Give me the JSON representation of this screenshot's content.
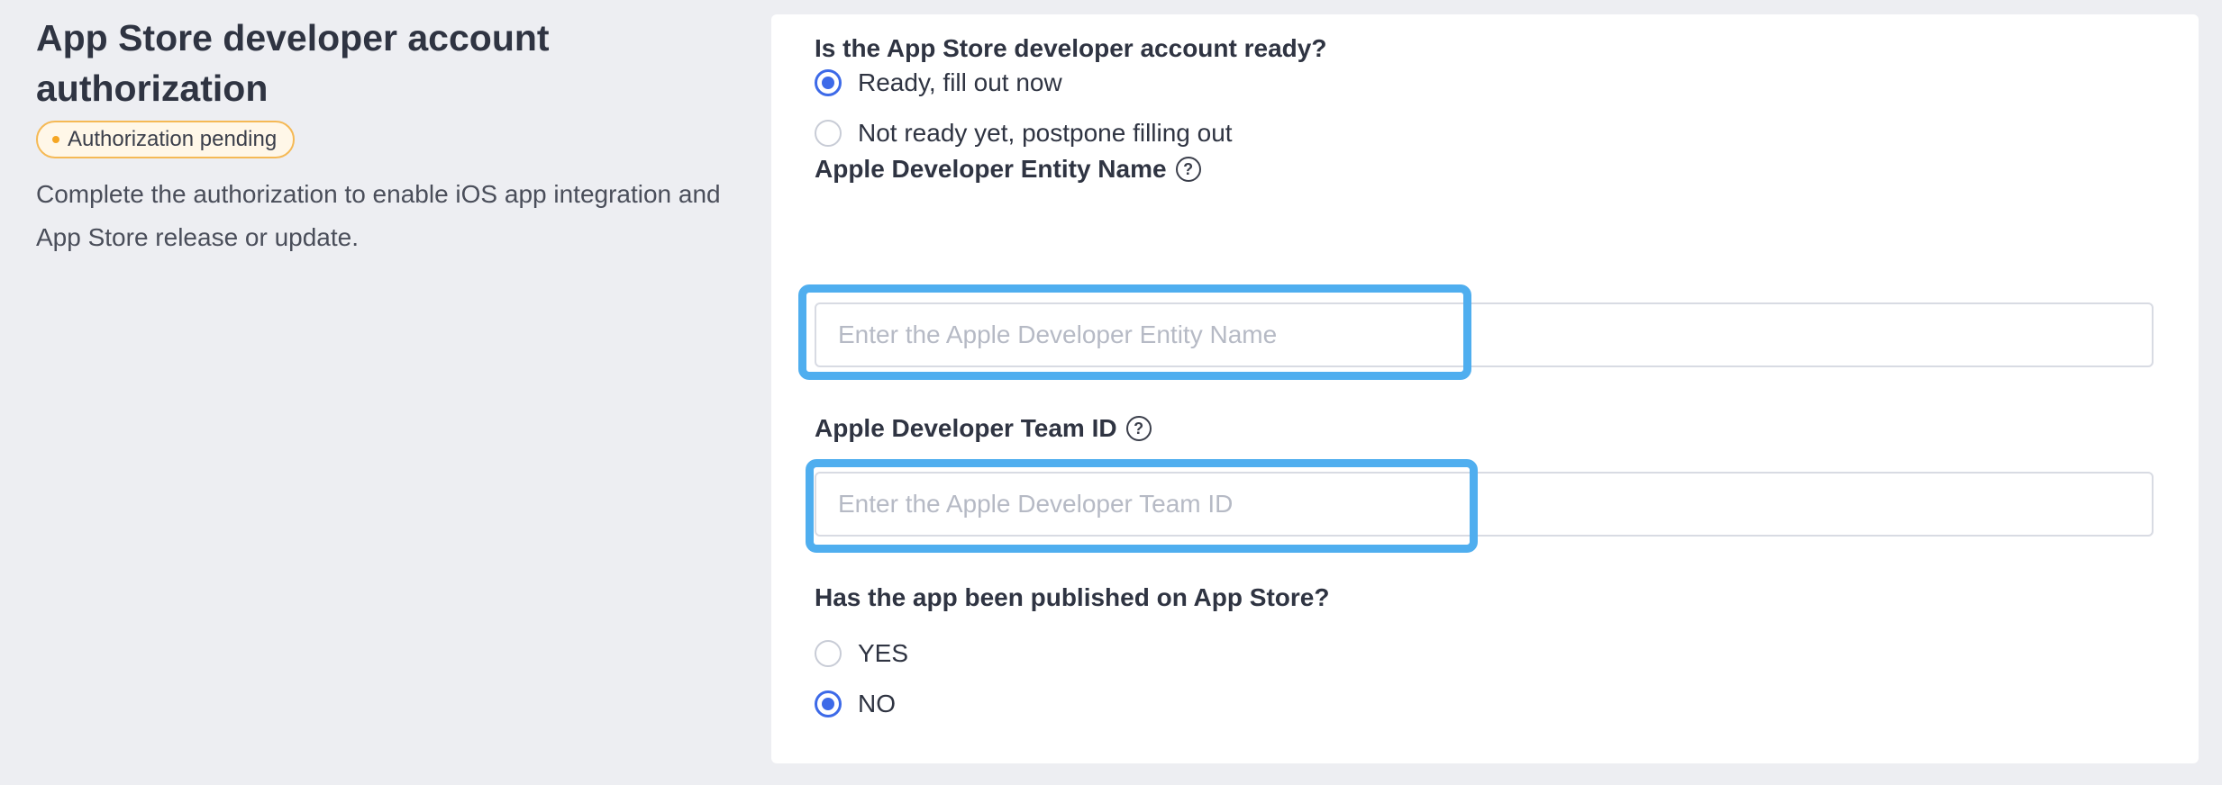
{
  "info": {
    "title": "App Store developer account authorization",
    "badge": "Authorization pending",
    "description": "Complete the authorization to enable iOS app integration and App Store release or update."
  },
  "form": {
    "account_ready": {
      "question": "Is the App Store developer account ready?",
      "options": [
        "Ready, fill out now",
        "Not ready yet, postpone filling out"
      ],
      "selected": "Ready, fill out now"
    },
    "entity_name": {
      "label": "Apple Developer Entity Name",
      "placeholder": "Enter the Apple Developer Entity Name",
      "value": ""
    },
    "team_id": {
      "label": "Apple Developer Team ID",
      "placeholder": "Enter the Apple Developer Team ID",
      "value": ""
    },
    "published": {
      "question": "Has the app been published on App Store?",
      "options": [
        "YES",
        "NO"
      ],
      "selected": "NO"
    },
    "help_glyph": "?"
  },
  "colors": {
    "accent": "#3d6ae8",
    "highlight": "#4faeef",
    "badge_border": "#f5b955"
  }
}
